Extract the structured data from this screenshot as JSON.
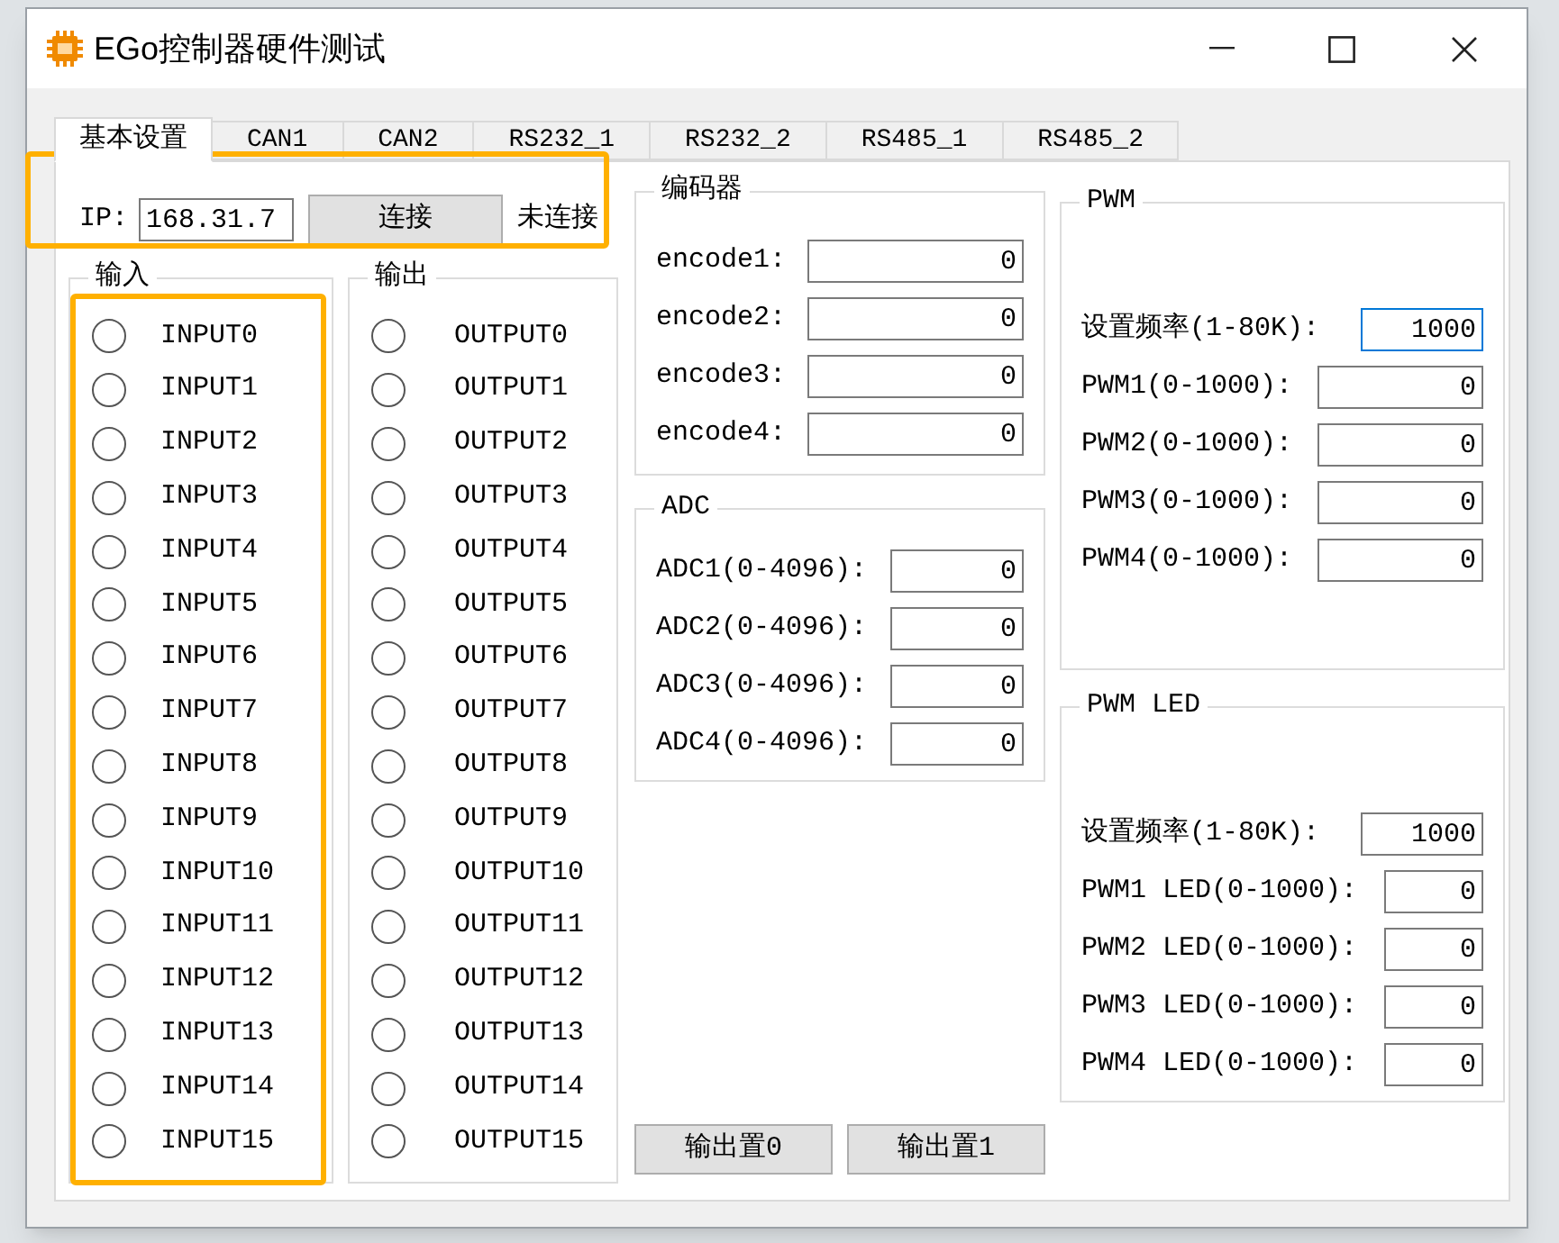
{
  "window": {
    "title": "EGo控制器硬件测试"
  },
  "tabs": [
    {
      "label": "基本设置",
      "selected": true
    },
    {
      "label": "CAN1",
      "selected": false
    },
    {
      "label": "CAN2",
      "selected": false
    },
    {
      "label": "RS232_1",
      "selected": false
    },
    {
      "label": "RS232_2",
      "selected": false
    },
    {
      "label": "RS485_1",
      "selected": false
    },
    {
      "label": "RS485_2",
      "selected": false
    }
  ],
  "ip": {
    "label": "IP:",
    "value": "168.31.7"
  },
  "connect_button": "连接",
  "connection_status": "未连接",
  "inputs": {
    "title": "输入",
    "items": [
      {
        "label": "INPUT0",
        "checked": false
      },
      {
        "label": "INPUT1",
        "checked": false
      },
      {
        "label": "INPUT2",
        "checked": false
      },
      {
        "label": "INPUT3",
        "checked": false
      },
      {
        "label": "INPUT4",
        "checked": false
      },
      {
        "label": "INPUT5",
        "checked": false
      },
      {
        "label": "INPUT6",
        "checked": false
      },
      {
        "label": "INPUT7",
        "checked": false
      },
      {
        "label": "INPUT8",
        "checked": false
      },
      {
        "label": "INPUT9",
        "checked": false
      },
      {
        "label": "INPUT10",
        "checked": false
      },
      {
        "label": "INPUT11",
        "checked": false
      },
      {
        "label": "INPUT12",
        "checked": false
      },
      {
        "label": "INPUT13",
        "checked": false
      },
      {
        "label": "INPUT14",
        "checked": false
      },
      {
        "label": "INPUT15",
        "checked": false
      }
    ]
  },
  "outputs": {
    "title": "输出",
    "items": [
      {
        "label": "OUTPUT0",
        "checked": false
      },
      {
        "label": "OUTPUT1",
        "checked": false
      },
      {
        "label": "OUTPUT2",
        "checked": false
      },
      {
        "label": "OUTPUT3",
        "checked": false
      },
      {
        "label": "OUTPUT4",
        "checked": false
      },
      {
        "label": "OUTPUT5",
        "checked": false
      },
      {
        "label": "OUTPUT6",
        "checked": false
      },
      {
        "label": "OUTPUT7",
        "checked": false
      },
      {
        "label": "OUTPUT8",
        "checked": false
      },
      {
        "label": "OUTPUT9",
        "checked": false
      },
      {
        "label": "OUTPUT10",
        "checked": false
      },
      {
        "label": "OUTPUT11",
        "checked": false
      },
      {
        "label": "OUTPUT12",
        "checked": false
      },
      {
        "label": "OUTPUT13",
        "checked": false
      },
      {
        "label": "OUTPUT14",
        "checked": false
      },
      {
        "label": "OUTPUT15",
        "checked": false
      }
    ]
  },
  "encoder": {
    "title": "编码器",
    "fields": [
      {
        "label": "encode1:",
        "value": "0"
      },
      {
        "label": "encode2:",
        "value": "0"
      },
      {
        "label": "encode3:",
        "value": "0"
      },
      {
        "label": "encode4:",
        "value": "0"
      }
    ]
  },
  "adc": {
    "title": "ADC",
    "fields": [
      {
        "label": "ADC1(0-4096):",
        "value": "0"
      },
      {
        "label": "ADC2(0-4096):",
        "value": "0"
      },
      {
        "label": "ADC3(0-4096):",
        "value": "0"
      },
      {
        "label": "ADC4(0-4096):",
        "value": "0"
      }
    ]
  },
  "output_buttons": [
    "输出置0",
    "输出置1"
  ],
  "pwm": {
    "title": "PWM",
    "fields": [
      {
        "label": "设置频率(1-80K):",
        "value": "1000",
        "focused": true
      },
      {
        "label": "PWM1(0-1000):",
        "value": "0",
        "focused": false
      },
      {
        "label": "PWM2(0-1000):",
        "value": "0",
        "focused": false
      },
      {
        "label": "PWM3(0-1000):",
        "value": "0",
        "focused": false
      },
      {
        "label": "PWM4(0-1000):",
        "value": "0",
        "focused": false
      }
    ]
  },
  "pwm_led": {
    "title": "PWM LED",
    "fields": [
      {
        "label": "设置频率(1-80K):",
        "value": "1000",
        "focused": false
      },
      {
        "label": "PWM1 LED(0-1000):",
        "value": "0",
        "focused": false
      },
      {
        "label": "PWM2 LED(0-1000):",
        "value": "0",
        "focused": false
      },
      {
        "label": "PWM3 LED(0-1000):",
        "value": "0",
        "focused": false
      },
      {
        "label": "PWM4 LED(0-1000):",
        "value": "0",
        "focused": false
      }
    ]
  }
}
